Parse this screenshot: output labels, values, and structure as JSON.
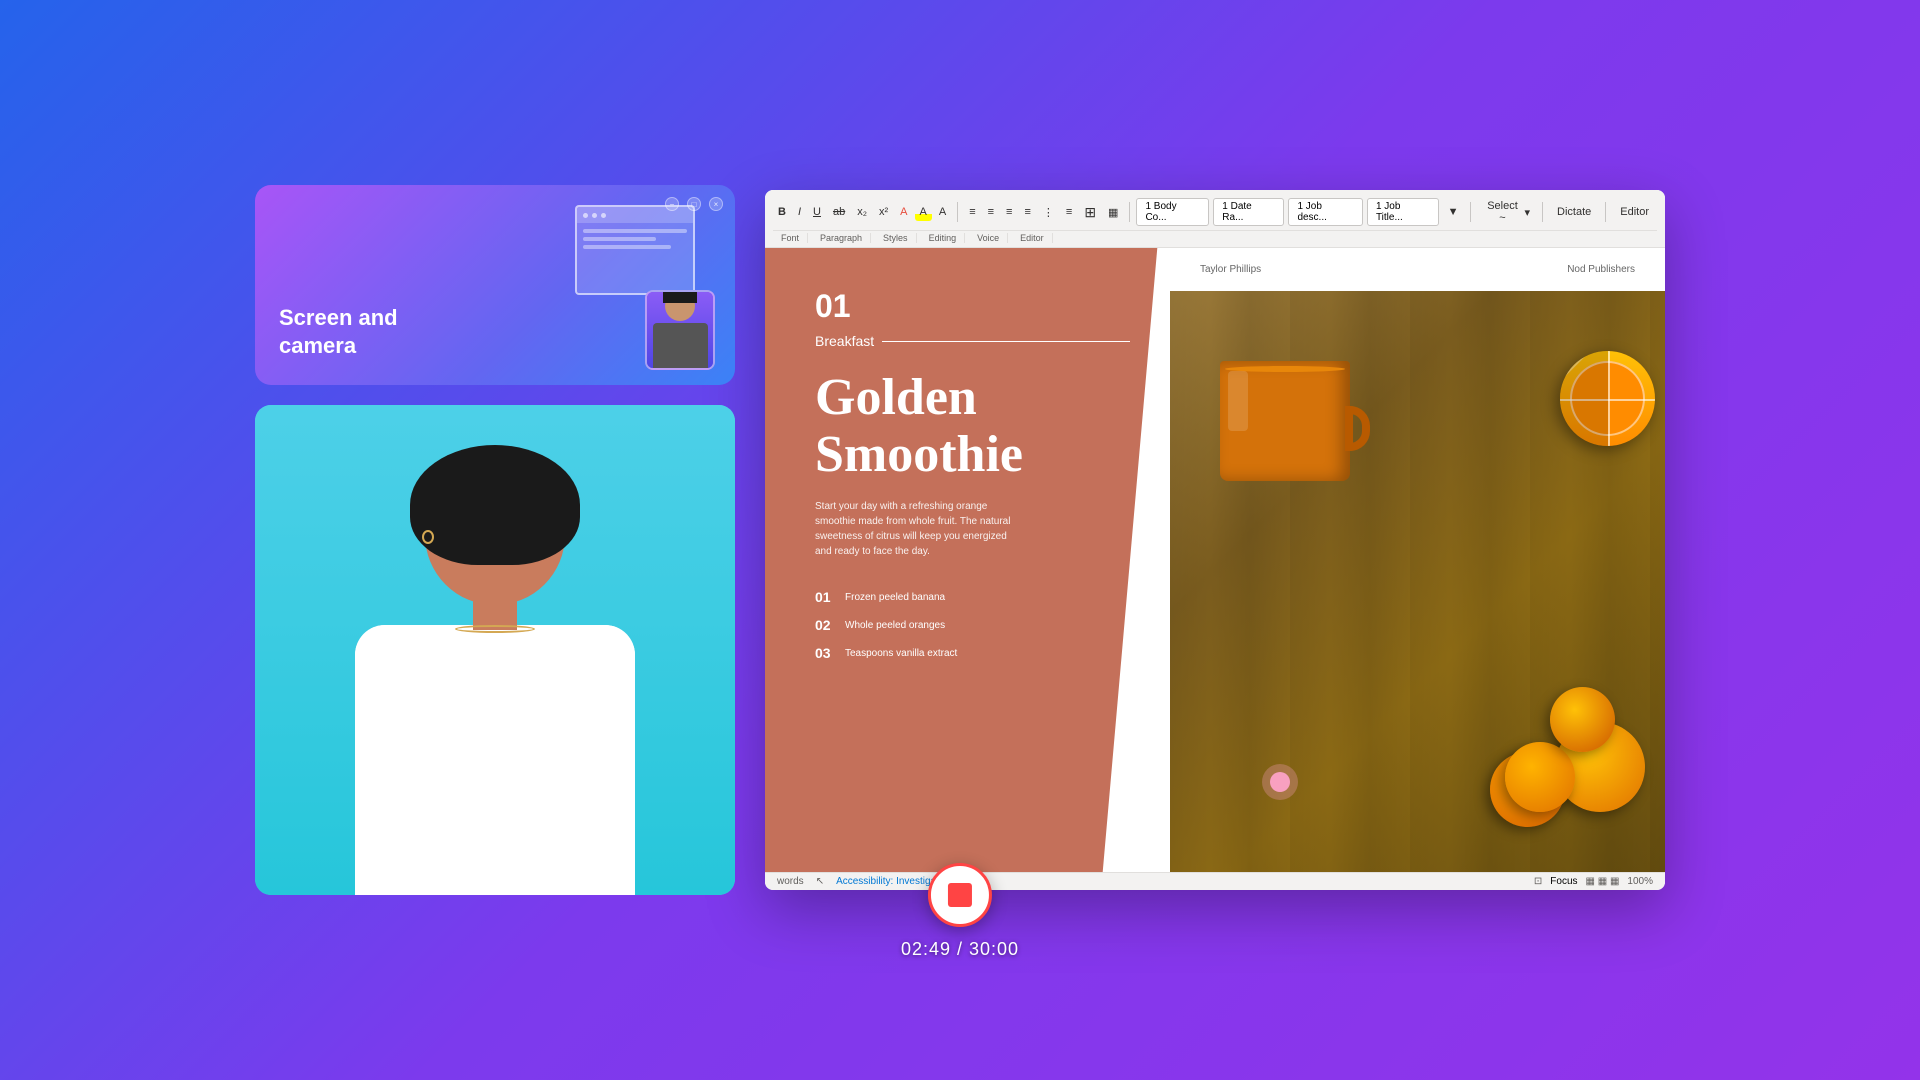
{
  "background": {
    "gradient": "linear-gradient(135deg, #2563eb 0%, #7c3aed 50%, #9333ea 100%)"
  },
  "left_panel": {
    "screen_camera_card": {
      "title": "Screen and\ncamera",
      "title_line1": "Screen and",
      "title_line2": "camera"
    },
    "camera_card": {
      "description": "Live camera feed"
    }
  },
  "word_toolbar": {
    "buttons": [
      "B",
      "I",
      "U",
      "ab",
      "x₂",
      "x²",
      "A",
      "A",
      "≡",
      "≡",
      "≡",
      "≡",
      "⋮",
      "≡"
    ],
    "sections": {
      "font": "Font",
      "paragraph": "Paragraph",
      "styles": "Styles",
      "editing": "Editing",
      "voice": "Voice",
      "editor": "Editor"
    },
    "style_pills": [
      "1 Body Co...",
      "1 Date Ra...",
      "1 Job desc...",
      "1 Job Title..."
    ],
    "select_label": "Select ~",
    "dictate_label": "Dictate",
    "editor_label": "Editor"
  },
  "document": {
    "left_section": {
      "number": "01",
      "category": "Breakfast",
      "title_line1": "Golden",
      "title_line2": "Smoothie",
      "description": "Start your day with a refreshing orange smoothie made from whole fruit. The natural sweetness of citrus will keep you energized and ready to face the day.",
      "ingredients": [
        {
          "num": "01",
          "text": "Frozen peeled banana"
        },
        {
          "num": "02",
          "text": "Whole peeled oranges"
        },
        {
          "num": "03",
          "text": "Teaspoons vanilla extract"
        }
      ]
    },
    "right_section": {
      "author": "Taylor Phillips",
      "publisher": "Nod Publishers"
    }
  },
  "statusbar": {
    "words_label": "words",
    "accessibility": "Accessibility: Investigate",
    "focus": "Focus",
    "zoom": "100%"
  },
  "recording": {
    "current_time": "02:49",
    "total_time": "30:00",
    "timer_display": "02:49 / 30:00"
  }
}
